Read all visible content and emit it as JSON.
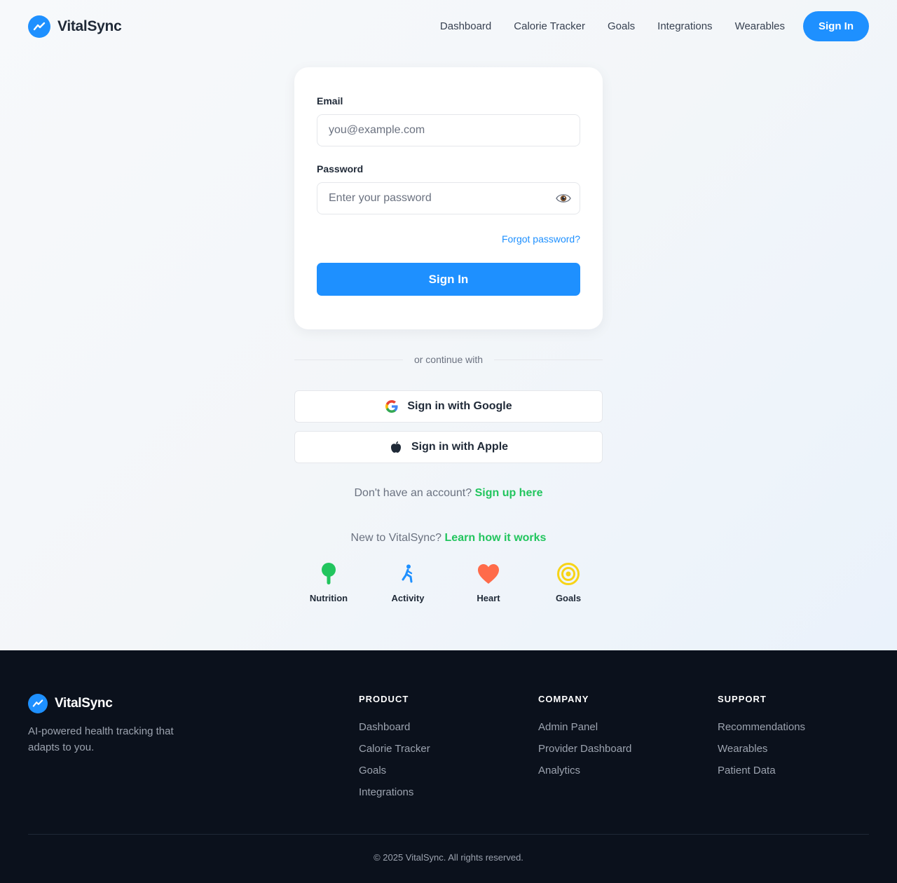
{
  "brand": {
    "name": "VitalSync"
  },
  "nav": {
    "links": [
      "Dashboard",
      "Calorie Tracker",
      "Goals",
      "Integrations",
      "Wearables"
    ],
    "signin_label": "Sign In"
  },
  "form": {
    "email_label": "Email",
    "email_placeholder": "you@example.com",
    "password_label": "Password",
    "password_placeholder": "Enter your password",
    "forgot_label": "Forgot password?",
    "submit_label": "Sign In"
  },
  "divider": {
    "text": "or continue with"
  },
  "social": {
    "google_label": "Sign in with Google",
    "apple_label": "Sign in with Apple"
  },
  "signup": {
    "prompt": "Don't have an account?",
    "link": "Sign up here"
  },
  "learn": {
    "prompt": "New to VitalSync?",
    "link": "Learn how it works"
  },
  "features": [
    {
      "label": "Nutrition",
      "icon": "nutrition-icon",
      "color": "#22c55e"
    },
    {
      "label": "Activity",
      "icon": "activity-icon",
      "color": "#1e90ff"
    },
    {
      "label": "Heart",
      "icon": "heart-icon",
      "color": "#ff6b4a"
    },
    {
      "label": "Goals",
      "icon": "target-icon",
      "color": "#f7d417"
    }
  ],
  "footer": {
    "tagline": "AI-powered health tracking that adapts to you.",
    "columns": [
      {
        "title": "PRODUCT",
        "items": [
          "Dashboard",
          "Calorie Tracker",
          "Goals",
          "Integrations"
        ]
      },
      {
        "title": "COMPANY",
        "items": [
          "Admin Panel",
          "Provider Dashboard",
          "Analytics"
        ]
      },
      {
        "title": "SUPPORT",
        "items": [
          "Recommendations",
          "Wearables",
          "Patient Data"
        ]
      }
    ],
    "copyright": "© 2025 VitalSync. All rights reserved."
  },
  "colors": {
    "primary": "#1e90ff",
    "accent_green": "#22c55e",
    "footer_bg": "#0b111c"
  }
}
